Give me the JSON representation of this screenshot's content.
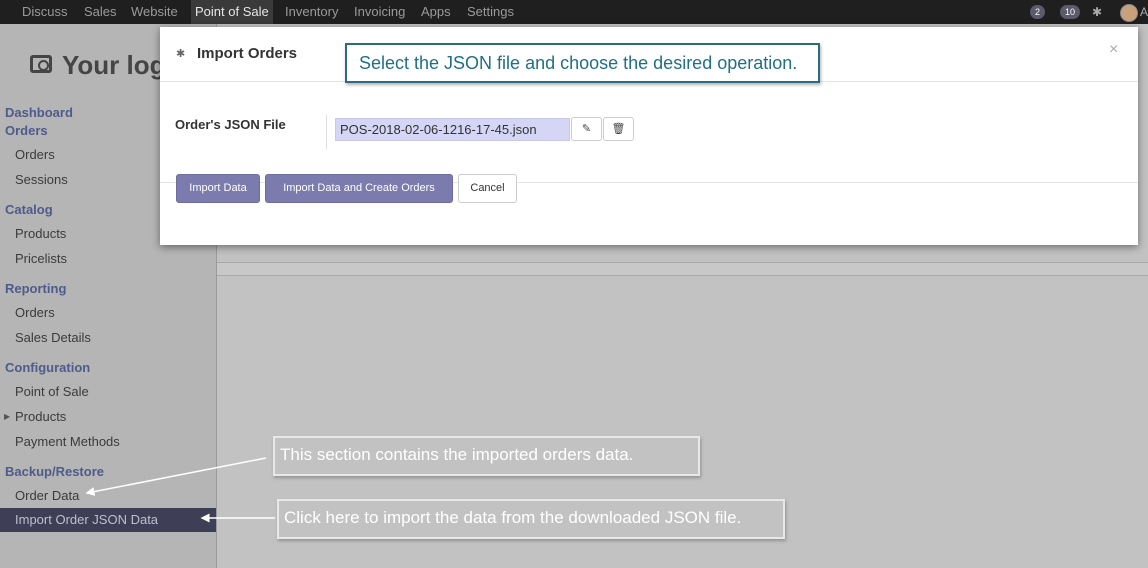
{
  "topnav": {
    "items": [
      "Discuss",
      "Sales",
      "Website",
      "Point of Sale",
      "Inventory",
      "Invoicing",
      "Apps",
      "Settings"
    ],
    "active": "Point of Sale",
    "chat_badge": "2",
    "activity_badge": "10",
    "user_initial": "A"
  },
  "app": {
    "logo_text": "Your log"
  },
  "sidebar": {
    "dashboard": "Dashboard",
    "orders_section": "Orders",
    "orders": "Orders",
    "sessions": "Sessions",
    "catalog_section": "Catalog",
    "products": "Products",
    "pricelists": "Pricelists",
    "reporting_section": "Reporting",
    "reporting_orders": "Orders",
    "sales_details": "Sales Details",
    "configuration_section": "Configuration",
    "point_of_sale": "Point of Sale",
    "config_products": "Products",
    "payment_methods": "Payment Methods",
    "backup_section": "Backup/Restore",
    "order_data": "Order Data",
    "import_order_json": "Import Order JSON Data"
  },
  "modal": {
    "title": "Import Orders",
    "close": "×",
    "field_label": "Order's JSON File",
    "file_value": "POS-2018-02-06-1216-17-45.json",
    "buttons": {
      "import_data": "Import Data",
      "import_and_create": "Import Data and Create Orders",
      "cancel": "Cancel"
    }
  },
  "callouts": {
    "top": "Select the JSON file and choose the desired operation.",
    "order_data": "This section contains the imported orders data.",
    "import_json": "Click here to import the data from the downloaded JSON file."
  },
  "colors": {
    "primary_button": "#7c7bad",
    "section_heading": "#4e5b8c",
    "callout_border": "#2d6c80"
  }
}
